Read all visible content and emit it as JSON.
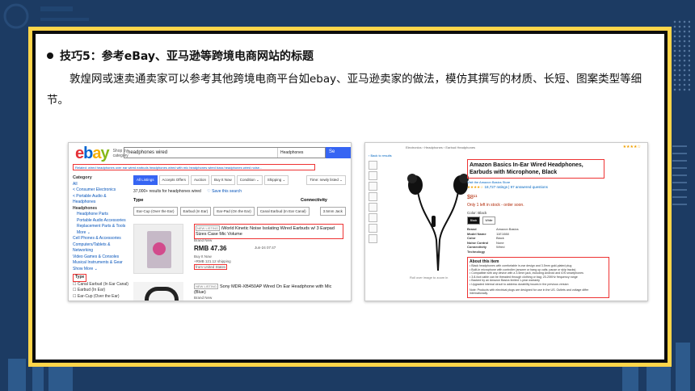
{
  "slide": {
    "bullet_title": "技巧5：参考eBay、亚马逊等跨境电商网站的标题",
    "paragraph": "敦煌网或速卖通卖家可以参考其他跨境电商平台如ebay、亚马逊卖家的做法，模仿其撰写的材质、长短、图案类型等细节。",
    "colors": {
      "background": "#1c3b63",
      "frame": "#ffd54a",
      "highlight": "#e33333"
    }
  },
  "ebay": {
    "logo": [
      "e",
      "b",
      "a",
      "y"
    ],
    "shop_by": "Shop by category",
    "search_value": "headphones wired",
    "category": "Headphones",
    "search_button": "Se",
    "related": "Related: wired headphones over ear   wired earbuds   headphones wired with mic   headphones wired bass   headphones wired noise...",
    "sidebar": {
      "heading": "Category",
      "items": [
        "All",
        "< Consumer Electronics",
        "< Portable Audio & Headphones",
        "Headphones",
        "Headphone Parts",
        "Portable Audio Accessories",
        "Replacement Parts & Tools",
        "More ⌄",
        "Cell Phones & Accessories",
        "Computers/Tablets & Networking",
        "Video Games & Consoles",
        "Musical Instruments & Gear",
        "Show More ⌄"
      ],
      "type_label": "Type",
      "type_options": [
        "Canal Earbud (In Ear Canal)",
        "Earbud (In Ear)",
        "Ear-Cup (Over the Ear)"
      ]
    },
    "tabs": [
      "All Listings",
      "Accepts Offers",
      "Auction",
      "Buy It Now",
      "Condition ⌄",
      "Shipping ⌄"
    ],
    "sort": "Time: newly listed ⌄",
    "results_count": "37,000+ results for headphones wired",
    "save_search": "♡ Save this search",
    "type_heading": "Type",
    "connectivity_heading": "Connectivity",
    "type_chips": [
      "Ear-Cup (Over the Ear)",
      "Earbud (In Ear)",
      "Ear-Pad (On the Ear)",
      "Canal Earbud (In Ear Canal)",
      "3.5mm Jack"
    ],
    "items": [
      {
        "tag": "NEW LISTING",
        "title": "iWorld Kinetic Noise Isolating Wired Earbuds w/ 3 Earpad Sizes Case Mic Volume",
        "condition": "Brand New",
        "price": "RMB 47.36",
        "time": "Jun-24 07:47",
        "buy": "Buy It Now",
        "shipping": "+RMB 121.12 shipping",
        "from": "from United States"
      },
      {
        "tag": "NEW LISTING",
        "title": "Sony MDR-XB450AP Wired On Ear Headphone with Mic (Blue)",
        "condition": "Brand New"
      }
    ]
  },
  "amazon": {
    "breadcrumb": "Electronics › Headphones › Earbud Headphones",
    "back": "‹ Back to results",
    "caption": "Roll over image to zoom in",
    "title": "Amazon Basics In-Ear Wired Headphones, Earbuds with Microphone, Black",
    "brand": "Visit the Amazon Basics Store",
    "rating": "★★★★☆",
    "ratings_count": "18,727 ratings | 97 answered questions",
    "price": "$8¹¹",
    "stock": "Only 1 left in stock - order soon.",
    "color_label": "Color: Black",
    "swatches": [
      "Black",
      "White"
    ],
    "specs": [
      [
        "Brand",
        "Amazon Basics"
      ],
      [
        "Model Name",
        "11E1088"
      ],
      [
        "Color",
        "Black"
      ],
      [
        "Noise Control",
        "None"
      ],
      [
        "Connectivity Technology",
        "Wired"
      ]
    ],
    "about_heading": "About this item",
    "about_items": [
      "• Black headphones with comfortable in-ear design and 3.5mm gold-plated plug",
      "• Built-in microphone with controller (answer or hang up calls; pause or skip tracks)",
      "• Compatible with any device with a 3.5mm jack, including Android and iOS smartphones",
      "• 3.8-foot cable can be threaded through clothing or bag; 20-20KHz frequency range",
      "• Backed by an Amazon Basics limited 1-year warranty",
      "• Upgraded internal circuit to address durability issues in the previous version"
    ],
    "note": "Note: Products with electrical plugs are designed for use in the US. Outlets and voltage differ internationally."
  }
}
